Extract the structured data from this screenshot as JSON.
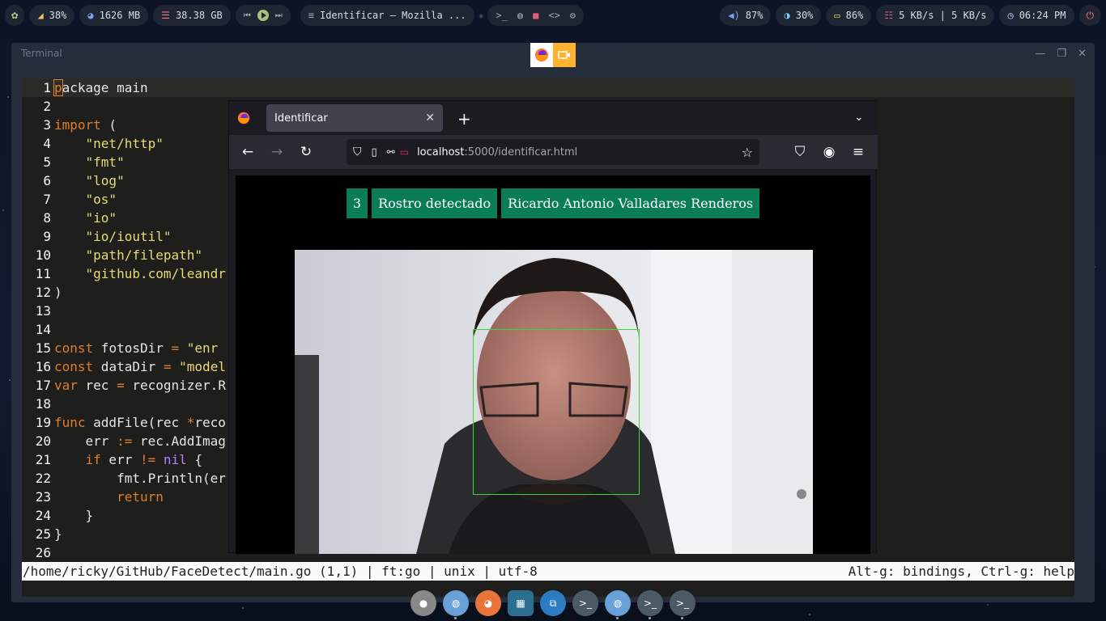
{
  "topbar": {
    "cpu": "38%",
    "memory": "1626 MB",
    "disk": "38.38 GB",
    "window_title": "Identificar — Mozilla ...",
    "volume": "87%",
    "brightness": "30%",
    "battery": "86%",
    "network": "5 KB/s | 5 KB/s",
    "clock": "06:24 PM"
  },
  "terminal": {
    "title": "Terminal",
    "lines": [
      {
        "n": "1",
        "text": "package main"
      },
      {
        "n": "2",
        "text": ""
      },
      {
        "n": "3",
        "text": "import ("
      },
      {
        "n": "4",
        "text": "    \"net/http\""
      },
      {
        "n": "5",
        "text": "    \"fmt\""
      },
      {
        "n": "6",
        "text": "    \"log\""
      },
      {
        "n": "7",
        "text": "    \"os\""
      },
      {
        "n": "8",
        "text": "    \"io\""
      },
      {
        "n": "9",
        "text": "    \"io/ioutil\""
      },
      {
        "n": "10",
        "text": "    \"path/filepath\""
      },
      {
        "n": "11",
        "text": "    \"github.com/leandr"
      },
      {
        "n": "12",
        "text": ")"
      },
      {
        "n": "13",
        "text": ""
      },
      {
        "n": "14",
        "text": ""
      },
      {
        "n": "15",
        "text": "const fotosDir = \"enr"
      },
      {
        "n": "16",
        "text": "const dataDir = \"model"
      },
      {
        "n": "17",
        "text": "var rec = recognizer.R"
      },
      {
        "n": "18",
        "text": ""
      },
      {
        "n": "19",
        "text": "func addFile(rec *reco"
      },
      {
        "n": "20",
        "text": "    err := rec.AddImag"
      },
      {
        "n": "21",
        "text": "    if err != nil {"
      },
      {
        "n": "22",
        "text": "        fmt.Println(er"
      },
      {
        "n": "23",
        "text": "        return"
      },
      {
        "n": "24",
        "text": "    }"
      },
      {
        "n": "25",
        "text": "}"
      },
      {
        "n": "26",
        "text": ""
      }
    ],
    "status_left": "/home/ricky/GitHub/FaceDetect/main.go (1,1) | ft:go | unix | utf-8",
    "status_right": "Alt-g: bindings, Ctrl-g: help"
  },
  "browser": {
    "tab_title": "Identificar",
    "url_host": "localhost",
    "url_rest": ":5000/identificar.html",
    "chips": [
      "3",
      "Rostro detectado",
      "Ricardo Antonio Valladares Renderos"
    ]
  },
  "colors": {
    "chip_green": "#0a7d56",
    "face_box": "#3bd63b",
    "keyword": "#e07d2a",
    "string": "#e6db74",
    "purple": "#ae81ff"
  }
}
